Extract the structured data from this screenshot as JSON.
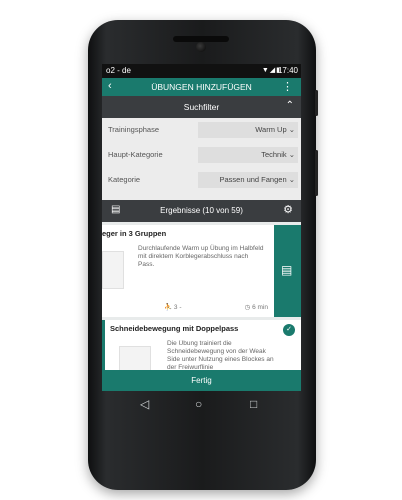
{
  "status_bar": {
    "carrier": "o2 - de",
    "icons": "▼◢▮",
    "time": "17:40"
  },
  "app_bar": {
    "back": "‹",
    "title": "ÜBUNGEN HINZUFÜGEN",
    "more": "⋮"
  },
  "filter_bar": {
    "title": "Suchfilter",
    "chevron": "⌃"
  },
  "filters": [
    {
      "label": "Trainingsphase",
      "value": "Warm Up ⌄"
    },
    {
      "label": "Haupt-Kategorie",
      "value": "Technik ⌄"
    },
    {
      "label": "Kategorie",
      "value": "Passen und Fangen ⌄"
    }
  ],
  "results_bar": {
    "title": "Ergebnisse (10 von 59)",
    "clip_icon": "▤",
    "gear_icon": "⚙"
  },
  "exercises": [
    {
      "name": "eger in 3 Gruppen",
      "description": "Durchlaufende Warm up Übung im Halbfeld mit direktem Korblegerabschluss nach Pass.",
      "players": "⛹ 3 -",
      "duration": "◷ 6 min",
      "action_icon": "▤"
    },
    {
      "name": "Schneidebewegung mit Doppelpass",
      "description": "Die Übung trainiert die Schneidebewegung von der Weak Side unter Nutzung eines Blockes an der Freiwurflinie",
      "check": "✓"
    }
  ],
  "fertig_button": "Fertig",
  "nav": {
    "back": "◁",
    "home": "○",
    "recent": "□"
  }
}
